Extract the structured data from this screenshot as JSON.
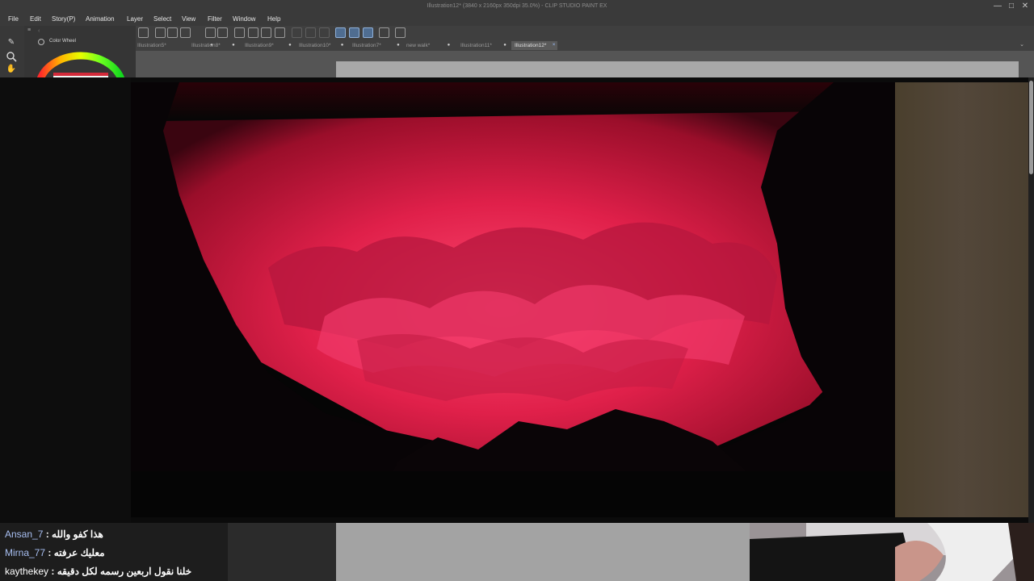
{
  "window": {
    "title": "Illustration12* (3840 x 2160px 350dpi 35.0%) - CLIP STUDIO PAINT EX",
    "minimize": "—",
    "restore": "□",
    "close": "✕"
  },
  "menu": [
    "File",
    "Edit",
    "Story(P)",
    "Animation",
    "Layer",
    "Select",
    "View",
    "Filter",
    "Window",
    "Help"
  ],
  "left_tools": {
    "pen_icon": "pen-icon",
    "zoom_icon": "zoom-icon",
    "hand_icon": "hand-icon"
  },
  "color_wheel": {
    "label": "Color Wheel"
  },
  "tabs": [
    {
      "label": "Illustration5*",
      "active": false
    },
    {
      "label": "Illustration8*",
      "active": false
    },
    {
      "label": "Illustration9*",
      "active": false
    },
    {
      "label": "Illustration10*",
      "active": false
    },
    {
      "label": "Illustration7*",
      "active": false
    },
    {
      "label": "new walk*",
      "active": false
    },
    {
      "label": "Illustration11*",
      "active": false
    },
    {
      "label": "Illustration12*",
      "active": true
    }
  ],
  "tab_dot": "●",
  "tab_close": "×",
  "tab_overflow": "⌄",
  "colors": {
    "accent": "#4f6d91",
    "canvas_red": "#e0204a",
    "bg_dark": "#0b0b0b",
    "panel_beige": "#4f4434",
    "chat_user": "#a8bff2"
  },
  "chat": [
    {
      "user": "Ansan_7",
      "sep": " : ",
      "message": "هذا كفو والله"
    },
    {
      "user": "Mirna_77",
      "sep": " : ",
      "message": "معليك عرفته"
    },
    {
      "user": "kaythekey",
      "sep": " : ",
      "message": "خلنا نقول اربعين رسمه لكل دقيقه"
    }
  ]
}
